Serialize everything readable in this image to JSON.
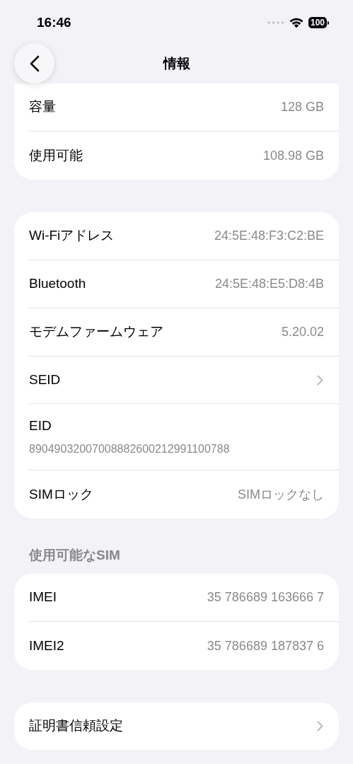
{
  "status_bar": {
    "time": "16:46",
    "battery": "100"
  },
  "nav": {
    "title": "情報"
  },
  "sections": [
    {
      "rows": [
        {
          "kind": "value",
          "label": "容量",
          "value": "128 GB"
        },
        {
          "kind": "value",
          "label": "使用可能",
          "value": "108.98 GB"
        }
      ]
    },
    {
      "rows": [
        {
          "kind": "value",
          "label": "Wi-Fiアドレス",
          "value": "24:5E:48:F3:C2:BE"
        },
        {
          "kind": "value",
          "label": "Bluetooth",
          "value": "24:5E:48:E5:D8:4B"
        },
        {
          "kind": "value",
          "label": "モデムファームウェア",
          "value": "5.20.02"
        },
        {
          "kind": "link",
          "label": "SEID"
        },
        {
          "kind": "stacked",
          "label": "EID",
          "value": "89049032007008882600212991100788"
        },
        {
          "kind": "value",
          "label": "SIMロック",
          "value": "SIMロックなし"
        }
      ]
    },
    {
      "header": "使用可能なSIM",
      "rows": [
        {
          "kind": "value",
          "label": "IMEI",
          "value": "35 786689 163666 7"
        },
        {
          "kind": "value",
          "label": "IMEI2",
          "value": "35 786689 187837 6"
        }
      ]
    },
    {
      "rows": [
        {
          "kind": "link",
          "label": "証明書信頼設定"
        }
      ]
    }
  ]
}
